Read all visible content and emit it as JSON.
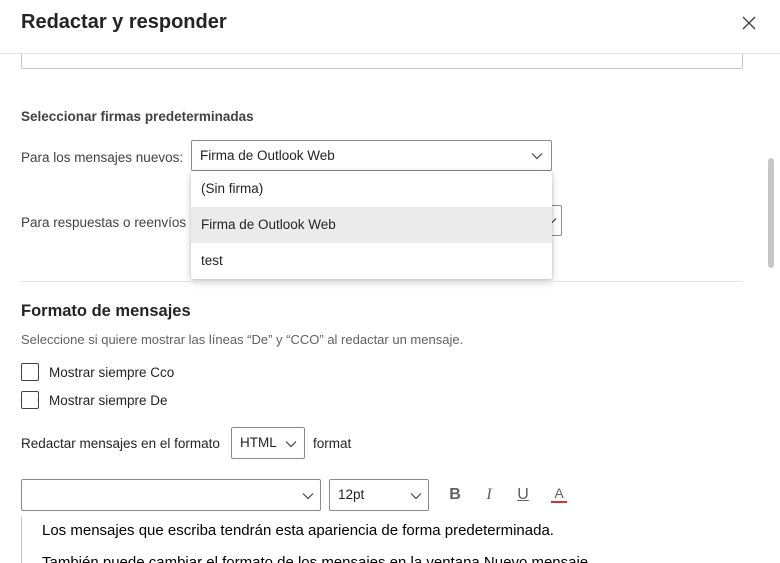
{
  "header": {
    "title": "Redactar y responder"
  },
  "signatures": {
    "heading": "Seleccionar firmas predeterminadas",
    "new_label": "Para los mensajes nuevos:",
    "new_value": "Firma de Outlook Web",
    "reply_label": "Para respuestas o reenvíos :",
    "options": [
      {
        "label": "(Sin firma)",
        "selected": false
      },
      {
        "label": "Firma de Outlook Web",
        "selected": true
      },
      {
        "label": "test",
        "selected": false
      }
    ]
  },
  "format": {
    "heading": "Formato de mensajes",
    "description": "Seleccione si quiere mostrar las líneas “De” y “CCO” al redactar un mensaje.",
    "show_bcc": "Mostrar siempre Cco",
    "show_from": "Mostrar siempre De",
    "compose_label": "Redactar mensajes en el formato",
    "compose_value": "HTML",
    "compose_after": "format"
  },
  "toolbar": {
    "font_value": "",
    "size_value": "12pt",
    "bold": "B",
    "italic": "I",
    "underline": "U",
    "font_color": "A",
    "font_color_hex": "#d13438"
  },
  "editor": {
    "line1": "Los mensajes que escriba tendrán esta apariencia de forma predeterminada.",
    "line2": "También puede cambiar el formato de los mensajes en la ventana Nuevo mensaje."
  }
}
